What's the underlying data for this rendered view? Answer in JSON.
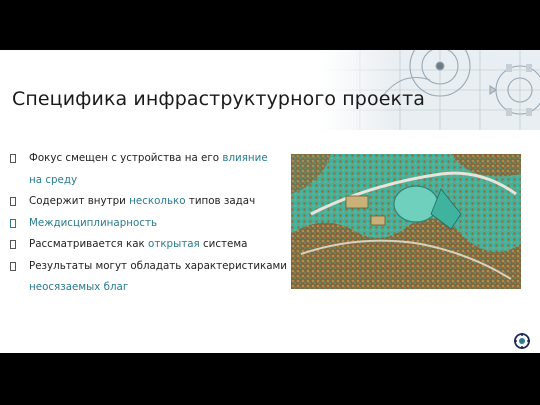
{
  "slide": {
    "title": "Специфика инфраструктурного проекта",
    "bullets": [
      {
        "parts": [
          "Фокус смещен с устройства на его ",
          "влияние"
        ],
        "line2_hl": "на среду"
      },
      {
        "parts": [
          "Содержит внутри ",
          "несколько",
          " типов задач"
        ]
      },
      {
        "text_hl": "Междисциплинарность"
      },
      {
        "parts": [
          "Рассматривается как ",
          "открытая",
          " система"
        ]
      },
      {
        "parts": [
          "Результаты могут обладать характеристиками"
        ],
        "line2_hl": "неосязаемых благ"
      }
    ]
  },
  "colors": {
    "accent": "#2a7b8e",
    "text": "#222222",
    "map_teal": "#3fb2a0",
    "map_brown": "#9a6a33"
  },
  "icons": {
    "bullet": "square-bullet-icon",
    "logo": "logo-icon",
    "decor": "gear-drawing-icon"
  }
}
